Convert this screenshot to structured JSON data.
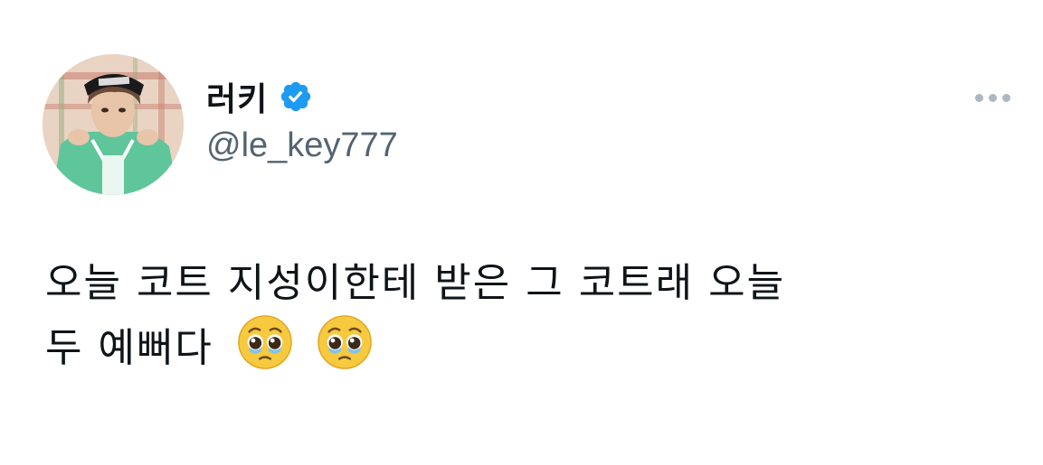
{
  "tweet": {
    "author": {
      "display_name": "러키",
      "handle": "@le_key777",
      "verified": true
    },
    "text_line1": "오늘 코트 지성이한테 받은 그 코트래 오늘",
    "text_line2": "두 예뻐다",
    "emojis": [
      "pleading-face",
      "pleading-face"
    ],
    "menu_icon": "more-dots-icon"
  },
  "colors": {
    "text": "#0f1419",
    "secondary": "#536471",
    "verified_blue": "#1d9bf0",
    "menu_dots": "#aab8c2"
  }
}
